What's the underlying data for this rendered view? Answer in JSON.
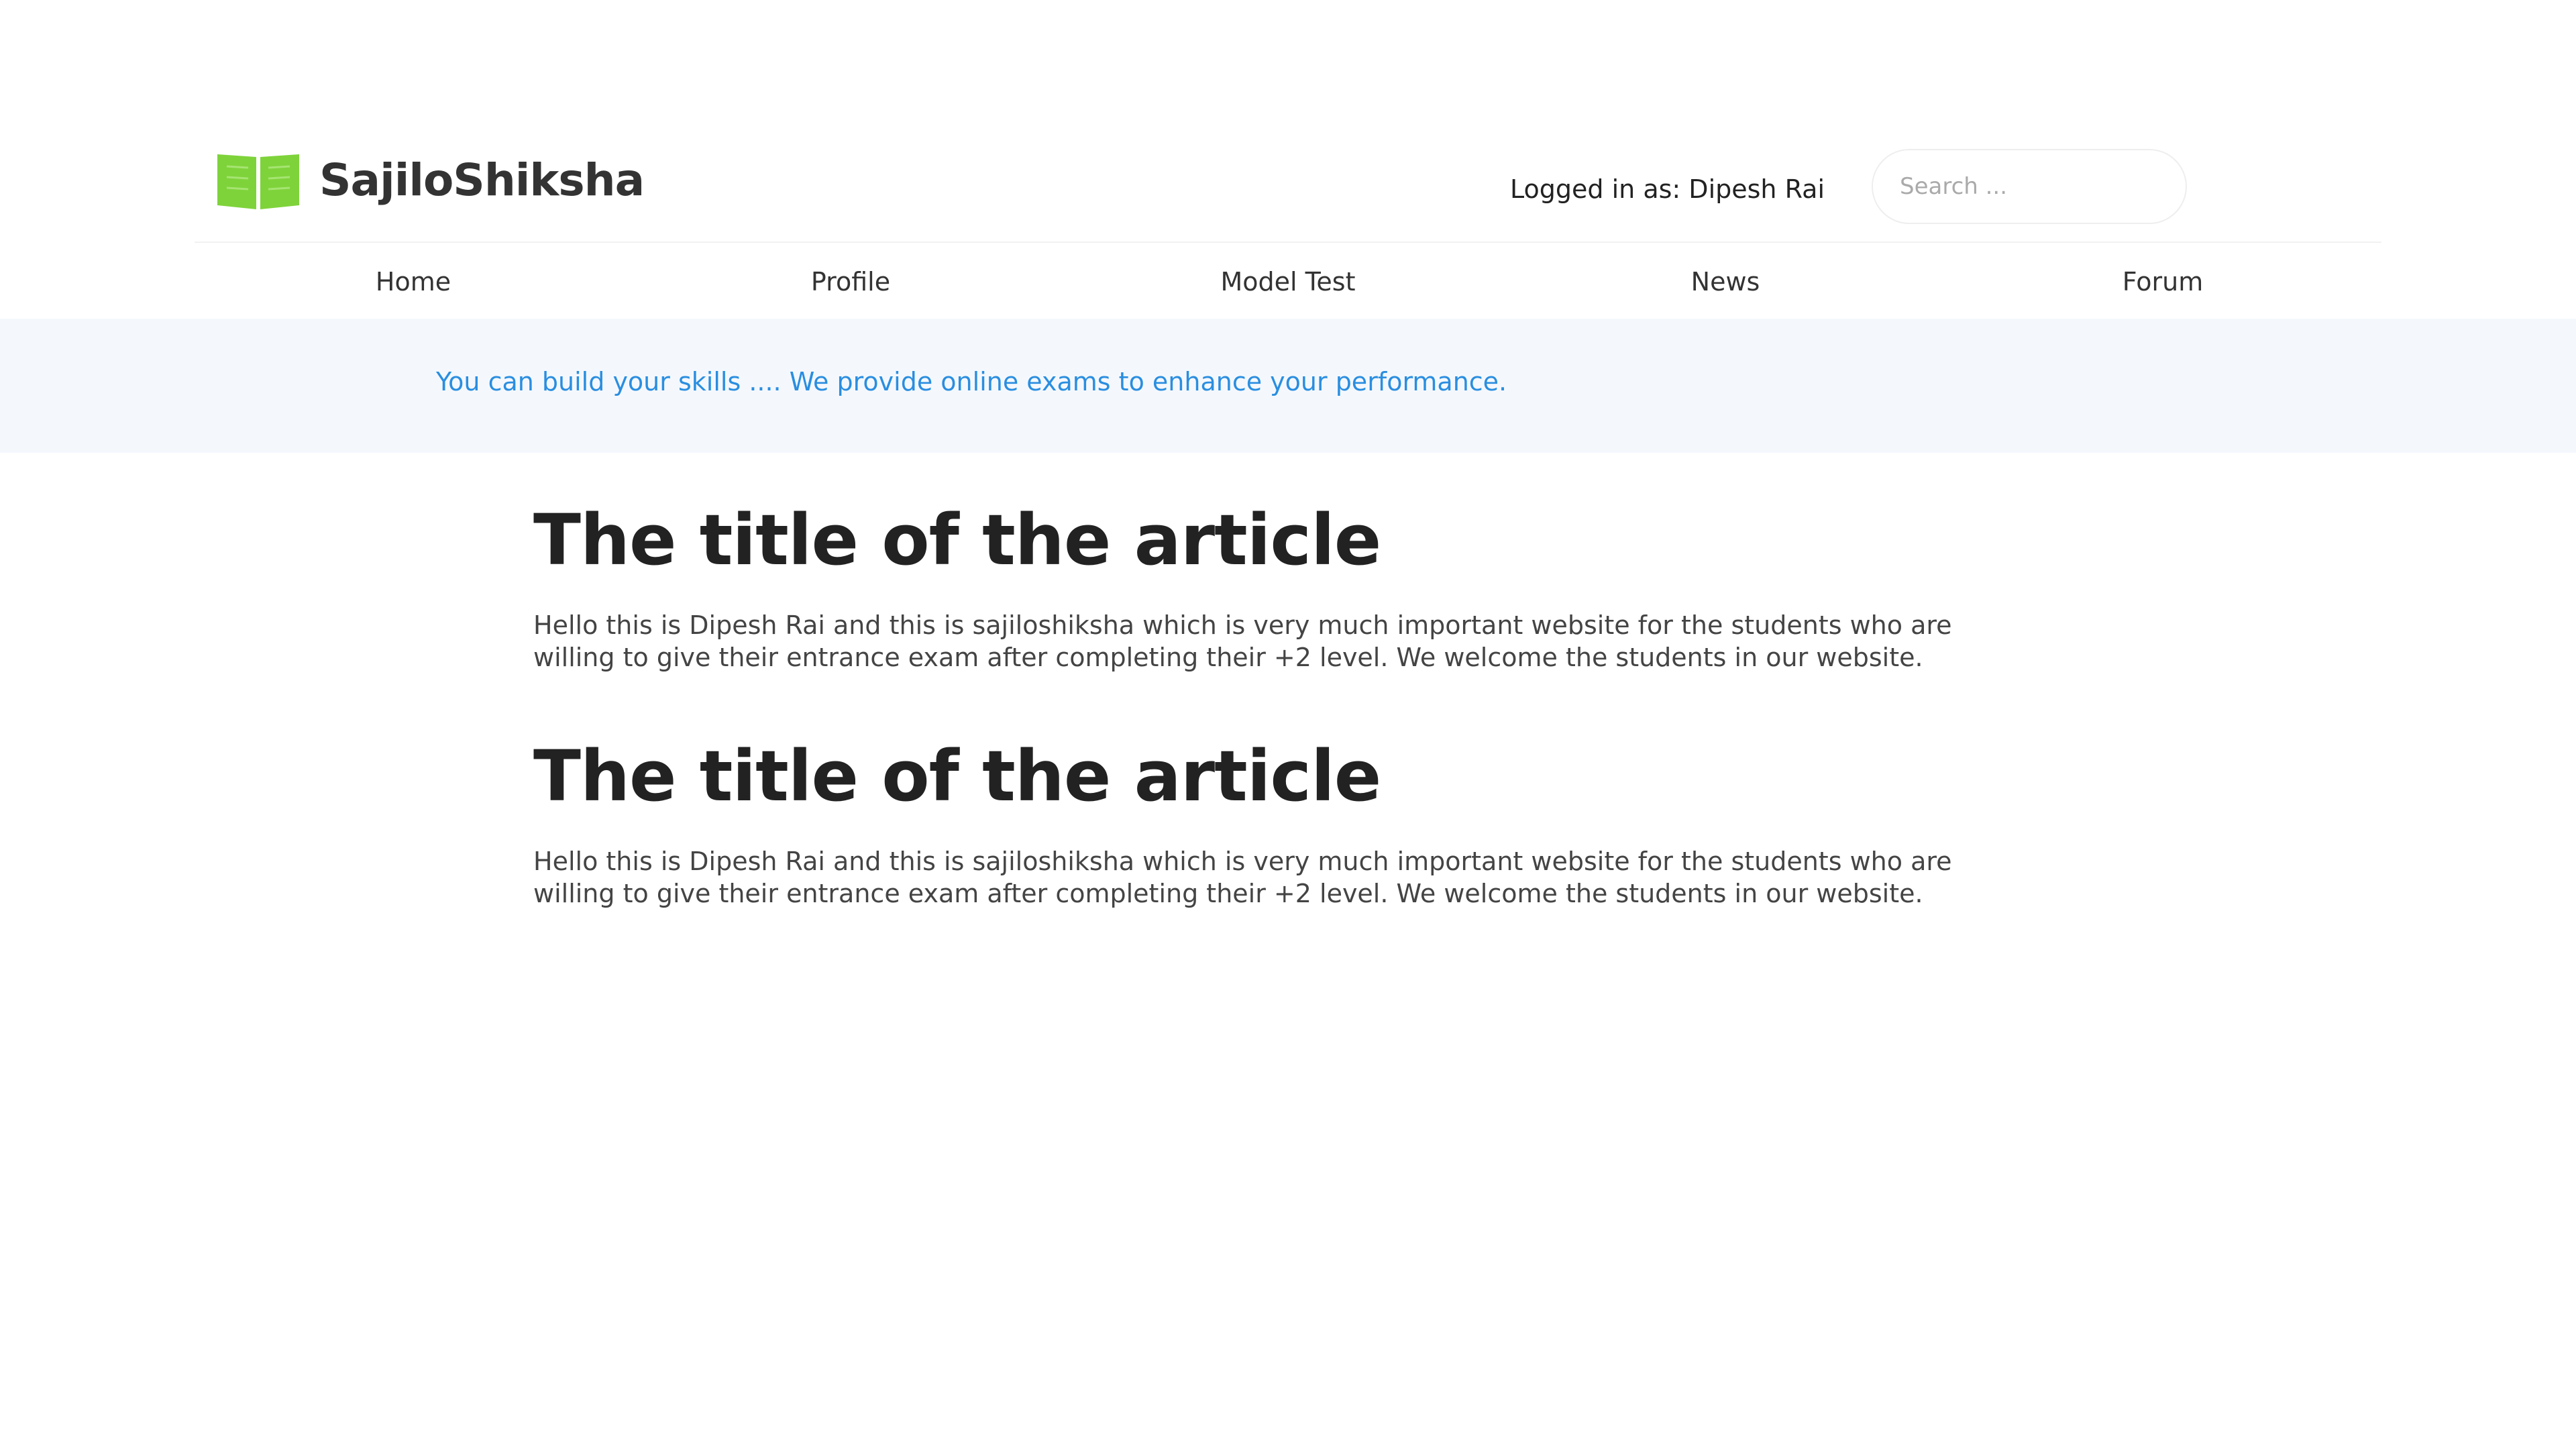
{
  "brand": {
    "name": "SajiloShiksha",
    "logo_icon": "open-book-icon",
    "logo_color": "#7ed33a"
  },
  "header": {
    "login_text": "Logged in as: Dipesh Rai",
    "search_placeholder": "Search ..."
  },
  "nav": {
    "items": [
      {
        "label": "Home"
      },
      {
        "label": "Profile"
      },
      {
        "label": "Model Test"
      },
      {
        "label": "News"
      },
      {
        "label": "Forum"
      }
    ]
  },
  "banner": {
    "text": "You can build your skills .... We provide online exams to enhance your performance.",
    "background": "#f4f8fd",
    "text_color": "#2a8ee0"
  },
  "articles": [
    {
      "title": "The title of the article",
      "body": "Hello this is Dipesh Rai and this is sajiloshiksha which is very much important website for the students who are willing to give their entrance exam after completing their +2 level. We welcome the students in our website."
    },
    {
      "title": "The title of the article",
      "body": "Hello this is Dipesh Rai and this is sajiloshiksha which is very much important website for the students who are willing to give their entrance exam after completing their +2 level. We welcome the students in our website."
    }
  ]
}
